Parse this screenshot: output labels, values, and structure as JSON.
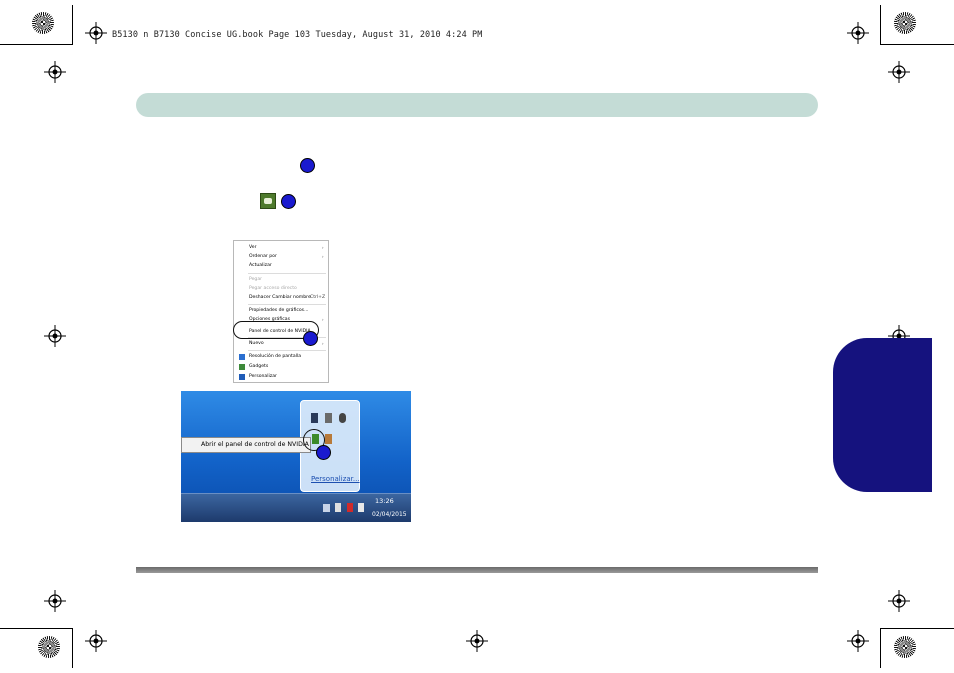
{
  "header": {
    "file_stamp": "B5130 n B7130 Concise UG.book  Page 103  Tuesday, August 31, 2010  4:24 PM"
  },
  "steps": {
    "marker_1": "",
    "marker_2": "",
    "nvidia_tray_icon": "nvidia-control-panel-icon"
  },
  "context_menu": {
    "items": [
      {
        "label": "Ver",
        "arrow": "›",
        "disabled": false
      },
      {
        "label": "Ordenar por",
        "arrow": "›",
        "disabled": false
      },
      {
        "label": "Actualizar",
        "arrow": "",
        "disabled": false
      },
      {
        "label": "Pegar",
        "arrow": "",
        "disabled": true
      },
      {
        "label": "Pegar acceso directo",
        "arrow": "",
        "disabled": true
      },
      {
        "label": "Deshacer Cambiar nombre",
        "shortcut": "Ctrl+Z",
        "arrow": "",
        "disabled": false
      },
      {
        "label": "Propiedades de gráficos...",
        "arrow": "",
        "disabled": false
      },
      {
        "label": "Opciones gráficas",
        "arrow": "›",
        "disabled": false
      },
      {
        "label": "Panel de control de NVIDIA",
        "arrow": "",
        "disabled": false
      },
      {
        "label": "Nuevo",
        "arrow": "›",
        "disabled": false
      },
      {
        "label": "Resolución de pantalla",
        "arrow": "",
        "disabled": false
      },
      {
        "label": "Gadgets",
        "arrow": "",
        "disabled": false
      },
      {
        "label": "Personalizar",
        "arrow": "",
        "disabled": false
      }
    ]
  },
  "tray_screenshot": {
    "tooltip": "Abrir el panel de control de NVIDIA",
    "customize_link": "Personalizar...",
    "clock_time": "13:26",
    "clock_date": "02/04/2015"
  },
  "colors": {
    "title_bar": "#c4dcd6",
    "side_tab": "#15127e",
    "marker": "#1a1acf",
    "footer_line": "#7a7a7a"
  }
}
